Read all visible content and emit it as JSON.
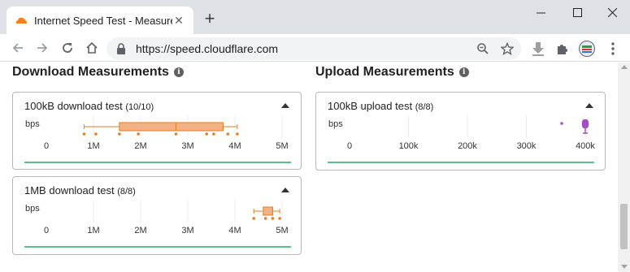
{
  "browser": {
    "tab_title": "Internet Speed Test - Measurement",
    "url": "https://speed.cloudflare.com"
  },
  "download": {
    "title": "Download Measurements",
    "cards": [
      {
        "name": "100kB download test",
        "count": "(10/10)"
      },
      {
        "name": "1MB download test",
        "count": "(8/8)"
      }
    ]
  },
  "upload": {
    "title": "Upload Measurements",
    "cards": [
      {
        "name": "100kB upload test",
        "count": "(8/8)"
      }
    ]
  },
  "colors": {
    "download_box": "#f4b183",
    "download_stroke": "#e67e22",
    "download_point": "#e67e22",
    "upload_point": "#a64ac9",
    "divider": "#58c18a"
  },
  "chart_data": [
    {
      "type": "boxplot",
      "title": "100kB download test",
      "ylabel": "bps",
      "x_ticks": [
        "0",
        "1M",
        "2M",
        "3M",
        "4M",
        "5M"
      ],
      "xlim": [
        0,
        5000000
      ],
      "box": {
        "min": 800000,
        "q1": 1550000,
        "median": 2750000,
        "q3": 3750000,
        "max": 4050000
      },
      "points": [
        800000,
        1050000,
        1550000,
        1950000,
        2750000,
        3400000,
        3550000,
        3850000,
        4050000
      ]
    },
    {
      "type": "boxplot",
      "title": "1MB download test",
      "ylabel": "bps",
      "x_ticks": [
        "0",
        "1M",
        "2M",
        "3M",
        "4M",
        "5M"
      ],
      "xlim": [
        0,
        5000000
      ],
      "box": {
        "min": 4400000,
        "q1": 4600000,
        "median": 4800000,
        "q3": 4800000,
        "max": 4950000
      },
      "points": [
        4400000,
        4650000,
        4800000,
        4950000
      ]
    },
    {
      "type": "boxplot",
      "title": "100kB upload test",
      "ylabel": "bps",
      "x_ticks": [
        "0",
        "100k",
        "200k",
        "300k",
        "400k"
      ],
      "xlim": [
        0,
        400000
      ],
      "box": {
        "min": 395000,
        "q1": 397000,
        "median": 398000,
        "q3": 400000,
        "max": 400000
      },
      "points": [
        360000,
        397000,
        400000
      ]
    }
  ]
}
